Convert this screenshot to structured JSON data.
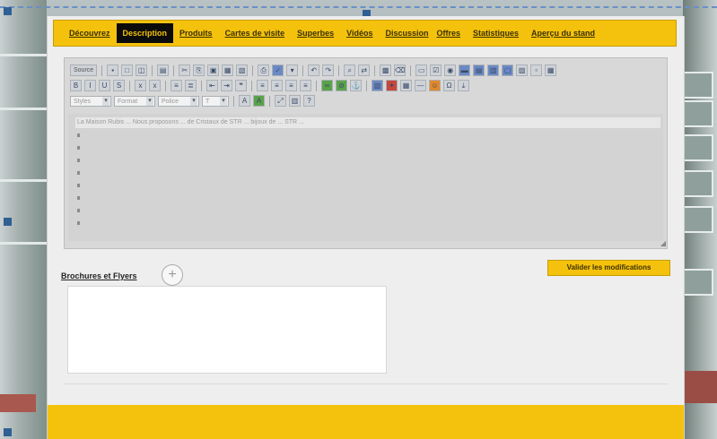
{
  "nav": {
    "items": [
      {
        "label": "Découvrez",
        "active": false
      },
      {
        "label": "Description",
        "active": true
      },
      {
        "label": "Produits",
        "active": false
      },
      {
        "label": "Cartes de visite",
        "active": false
      },
      {
        "label": "Superbes",
        "active": false
      },
      {
        "label": "Vidéos",
        "active": false
      },
      {
        "label": "Discussion",
        "active": false
      },
      {
        "label": "Offres",
        "active": false
      },
      {
        "label": "Statistiques",
        "active": false
      },
      {
        "label": "Aperçu du stand",
        "active": false
      }
    ]
  },
  "editor": {
    "source_label": "Source",
    "format_select": "Styles",
    "font_select": "Format",
    "size_select": "Police",
    "size2_select": "T",
    "first_line": "La Maison Rubis ... Nous proposons ... de Cristaux de STR ... bijoux de ... STR ..."
  },
  "brochures": {
    "label": "Brochures et Flyers"
  },
  "actions": {
    "validate_label": "Valider les modifications"
  },
  "colors": {
    "accent": "#f4c20d",
    "active_tab": "#0b0b0b",
    "handle": "#2f5f93"
  }
}
